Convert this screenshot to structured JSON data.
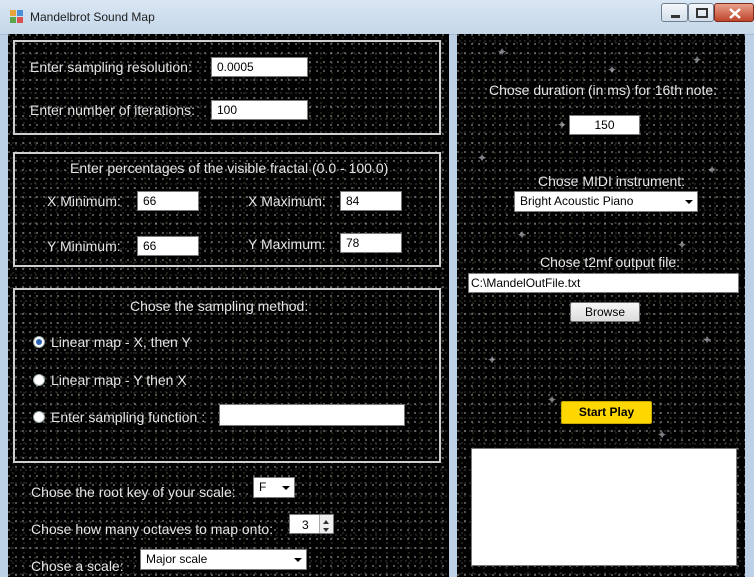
{
  "window": {
    "title": "Mandelbrot Sound Map",
    "controls": {
      "minimize": "minimize",
      "maximize": "maximize",
      "close": "close"
    }
  },
  "sampling": {
    "resolution_label": "Enter sampling resolution:",
    "resolution_value": "0.0005",
    "iterations_label": "Enter number of iterations:",
    "iterations_value": "100"
  },
  "percentages": {
    "heading": "Enter percentages of the visible fractal (0.0 - 100.0)",
    "x_min_label": "X Minimum:",
    "x_min_value": "66",
    "x_max_label": "X Maximum:",
    "x_max_value": "84",
    "y_min_label": "Y Minimum:",
    "y_min_value": "66",
    "y_max_label": "Y Maximum:",
    "y_max_value": "78"
  },
  "method": {
    "heading": "Chose the sampling method:",
    "options": [
      {
        "label": "Linear map - X, then Y",
        "checked": true
      },
      {
        "label": "Linear map - Y then X",
        "checked": false
      },
      {
        "label": "Enter sampling function :",
        "checked": false
      }
    ],
    "function_value": ""
  },
  "scale": {
    "root_key_label": "Chose the root key of your scale:",
    "root_key_value": "F",
    "octaves_label": "Chose how many octaves to map onto:",
    "octaves_value": "3",
    "scale_label": "Chose a scale:",
    "scale_value": "Major scale"
  },
  "right": {
    "duration_label": "Chose duration (in ms) for 16th note:",
    "duration_value": "150",
    "instrument_label": "Chose MIDI instrument:",
    "instrument_value": "Bright Acoustic Piano",
    "output_label": "Chose t2mf output file:",
    "output_value": "C:\\MandelOutFile.txt",
    "browse_label": "Browse",
    "start_label": "Start Play",
    "log_text": ""
  },
  "colors": {
    "start_button": "#ffd700",
    "panel_border": "#cfcfcf",
    "background": "#000000"
  }
}
